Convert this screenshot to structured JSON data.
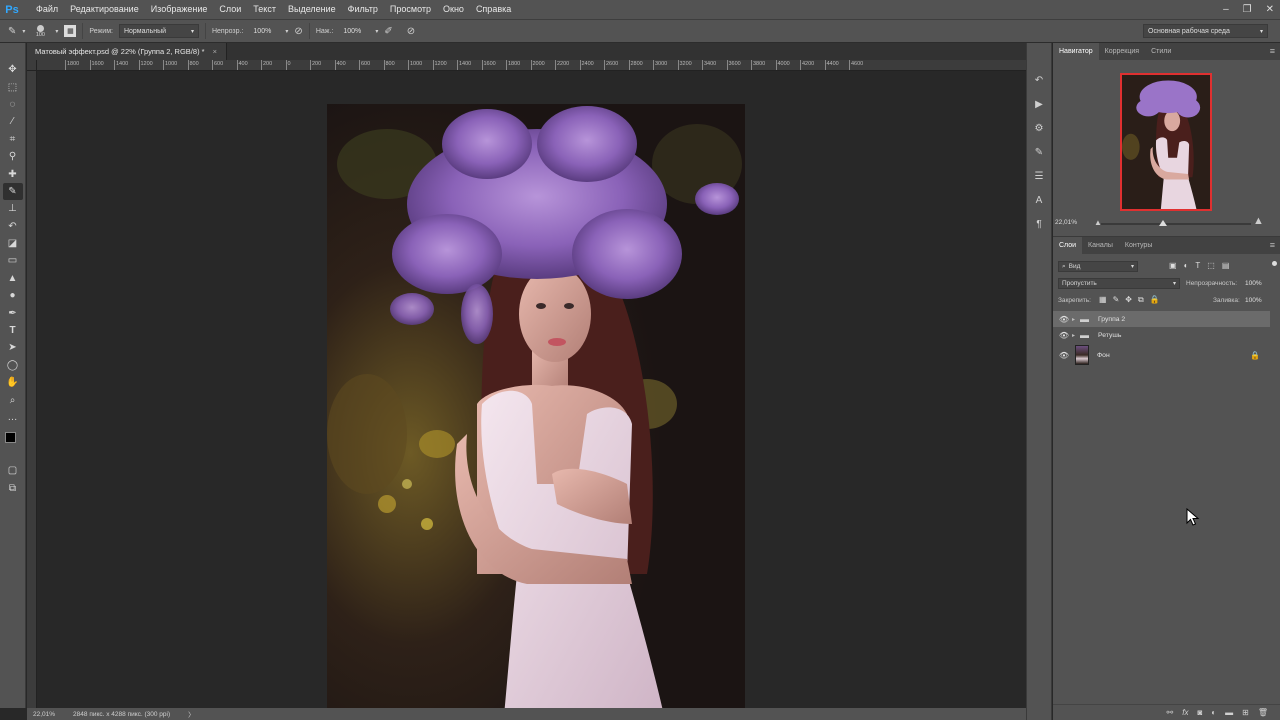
{
  "app": {
    "logo": "Ps"
  },
  "menu": [
    "Файл",
    "Редактирование",
    "Изображение",
    "Слои",
    "Текст",
    "Выделение",
    "Фильтр",
    "Просмотр",
    "Окно",
    "Справка"
  ],
  "options": {
    "brush_size": "100",
    "mode_label": "Режим:",
    "mode_value": "Нормальный",
    "opacity_label": "Непрозр.:",
    "opacity_value": "100%",
    "pressure_label": "Наж.:",
    "pressure_value": "100%",
    "workspace": "Основная рабочая среда"
  },
  "document": {
    "tab_title": "Матовый эффект.psd @ 22% (Группа 2, RGB/8) *",
    "ruler_labels": [
      "1800",
      "1600",
      "1400",
      "1200",
      "1000",
      "800",
      "600",
      "400",
      "200",
      "0",
      "200",
      "400",
      "600",
      "800",
      "1000",
      "1200",
      "1400",
      "1600",
      "1800",
      "2000",
      "2200",
      "2400",
      "2600",
      "2800",
      "3000",
      "3200",
      "3400",
      "3600",
      "3800",
      "4000",
      "4200",
      "4400",
      "4600"
    ]
  },
  "status": {
    "zoom": "22,01%",
    "doc_info": "2848 пикс. x 4288 пикс. (300 ppi)"
  },
  "navigator": {
    "tabs": [
      "Навигатор",
      "Коррекция",
      "Стили"
    ],
    "zoom": "22,01%"
  },
  "layers_panel": {
    "tabs": [
      "Слои",
      "Каналы",
      "Контуры"
    ],
    "filter": "Вид",
    "blend_mode": "Пропустить",
    "opacity_label": "Непрозрачность:",
    "opacity_value": "100%",
    "lock_label": "Закрепить:",
    "fill_label": "Заливка:",
    "fill_value": "100%",
    "layers": [
      {
        "name": "Группа 2",
        "type": "group",
        "selected": true
      },
      {
        "name": "Ретушь",
        "type": "group",
        "selected": false
      },
      {
        "name": "Фон",
        "type": "image",
        "selected": false,
        "locked": true
      }
    ]
  },
  "icons": {
    "tools": [
      "move-icon",
      "marquee-icon",
      "lasso-icon",
      "magic-wand-icon",
      "crop-icon",
      "eyedropper-icon",
      "healing-brush-icon",
      "brush-icon",
      "clone-stamp-icon",
      "history-brush-icon",
      "eraser-icon",
      "gradient-icon",
      "blur-icon",
      "dodge-icon",
      "pen-icon",
      "type-icon",
      "path-selection-icon",
      "shape-icon",
      "hand-icon",
      "zoom-icon",
      "more-tools-icon"
    ]
  }
}
